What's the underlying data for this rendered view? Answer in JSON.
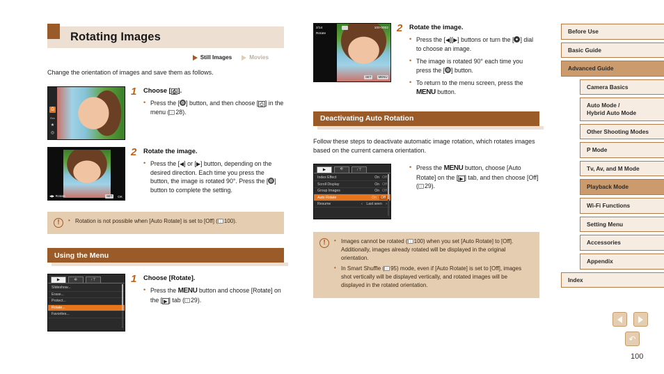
{
  "page": {
    "number": "100",
    "chapter_title": "Rotating Images",
    "media_tags": {
      "still": "Still Images",
      "movies": "Movies"
    },
    "intro": "Change the orientation of images and save them as follows."
  },
  "steps_left": [
    {
      "num": "1",
      "head_pre": "Choose [",
      "head_post": "].",
      "bullets": [
        {
          "pre": "Press the [",
          "mid": "] button, and then choose [",
          "post": "] in the menu (",
          "ref": "28",
          "end": ")."
        }
      ]
    },
    {
      "num": "2",
      "head": "Rotate the image.",
      "bullets": [
        {
          "pre": "Press the [",
          "mid": "] or [",
          "post": "] button, depending on the desired direction. Each time you press the button, the image is rotated 90°. Press the [",
          "end": "] button to complete the setting."
        }
      ]
    }
  ],
  "note_left": {
    "items": [
      {
        "pre": "Rotation is not possible when [Auto Rotate] is set to [Off] (",
        "ref": "100",
        "post": ")."
      }
    ]
  },
  "section_using_menu": {
    "title": "Using the Menu",
    "step": {
      "num": "1",
      "head": "Choose [Rotate].",
      "bullet": {
        "pre": "Press the ",
        "menu": "MENU",
        "mid": " button and choose [Rotate] on the [",
        "post": "] tab (",
        "ref": "29",
        "end": ")."
      }
    }
  },
  "step_right": {
    "num": "2",
    "head": "Rotate the image.",
    "bullets": [
      {
        "pre": "Press the [",
        "mid": "][",
        "mid2": "] buttons or turn the [",
        "post": "] dial to choose an image."
      },
      {
        "pre": "The image is rotated 90° each time you press the [",
        "post": "] button."
      },
      {
        "pre": "To return to the menu screen, press the ",
        "menu": "MENU",
        "post": " button."
      }
    ]
  },
  "section_deactivating": {
    "title": "Deactivating Auto Rotation",
    "intro": "Follow these steps to deactivate automatic image rotation, which rotates images based on the current camera orientation.",
    "bullet": {
      "pre": "Press the ",
      "menu": "MENU",
      "mid": " button, choose [Auto Rotate] on the [",
      "post": "] tab, and then choose [Off] (",
      "ref": "29",
      "end": ")."
    }
  },
  "note_right": {
    "items": [
      {
        "pre": "Images cannot be rotated (",
        "ref": "100",
        "post": ") when you set [Auto Rotate] to [Off]. Additionally, images already rotated will be displayed in the original orientation."
      },
      {
        "pre": "In Smart Shuffle (",
        "ref": "95",
        "post": ") mode, even if [Auto Rotate] is set to [Off], images shot vertically will be displayed vertically, and rotated images will be displayed in the rotated orientation."
      }
    ]
  },
  "camera_screens": {
    "playback_func": {
      "icon_selected": "rotate-icon",
      "strip_icons": [
        "rotate",
        "erase",
        "star",
        "print"
      ]
    },
    "rotate_edit": {
      "hint_left": "Rotate",
      "hint_right_set": "SET",
      "hint_right_ok": "OK"
    },
    "rotate_view": {
      "counter": "2/14",
      "label": "Rotate",
      "file": "100-0002",
      "set_badge": "SET",
      "menu_badge": "MENU"
    },
    "playback_menu": {
      "tabs": [
        "play-tab",
        "print-tab",
        "setup-tab"
      ],
      "rows": [
        {
          "label": "Slideshow...",
          "value": ""
        },
        {
          "label": "Erase...",
          "value": ""
        },
        {
          "label": "Protect...",
          "value": ""
        },
        {
          "label": "Rotate...",
          "value": "",
          "selected": true
        },
        {
          "label": "Favorites...",
          "value": ""
        }
      ]
    },
    "auto_rotate_menu": {
      "tabs": [
        "play-tab",
        "print-tab",
        "setup-tab"
      ],
      "rows": [
        {
          "label": "Index Effect",
          "on": "On",
          "off": "Off"
        },
        {
          "label": "Scroll Display",
          "on": "On",
          "off": "Off"
        },
        {
          "label": "Group Images",
          "on": "On",
          "off": "Off"
        },
        {
          "label": "Auto Rotate",
          "on": "On",
          "off": "Off",
          "selected": true
        },
        {
          "label": "Resume",
          "value": "Last seen"
        }
      ]
    }
  },
  "sidebar": {
    "items": [
      {
        "label": "Before Use",
        "level": 1,
        "active": false
      },
      {
        "label": "Basic Guide",
        "level": 1,
        "active": false
      },
      {
        "label": "Advanced Guide",
        "level": 1,
        "active": true
      },
      {
        "label": "Camera Basics",
        "level": 2,
        "active": false
      },
      {
        "label": "Auto Mode /\nHybrid Auto Mode",
        "level": 2,
        "active": false
      },
      {
        "label": "Other Shooting Modes",
        "level": 2,
        "active": false
      },
      {
        "label": "P Mode",
        "level": 2,
        "active": false
      },
      {
        "label": "Tv, Av, and M Mode",
        "level": 2,
        "active": false
      },
      {
        "label": "Playback Mode",
        "level": 2,
        "active": true
      },
      {
        "label": "Wi-Fi Functions",
        "level": 2,
        "active": false
      },
      {
        "label": "Setting Menu",
        "level": 2,
        "active": false
      },
      {
        "label": "Accessories",
        "level": 2,
        "active": false
      },
      {
        "label": "Appendix",
        "level": 2,
        "active": false
      },
      {
        "label": "Index",
        "level": 1,
        "active": false
      }
    ]
  },
  "pagenav": {
    "prev": "previous-page",
    "next": "next-page",
    "home": "home"
  },
  "colors": {
    "accent_brown": "#9a5b28",
    "band_beige": "#ede0d2",
    "note_bg": "#e4cdb0",
    "nav_active": "#cb9a6d",
    "nav_bg": "#f6ece1",
    "step_orange": "#c26016",
    "menu_highlight": "#e8741c"
  }
}
